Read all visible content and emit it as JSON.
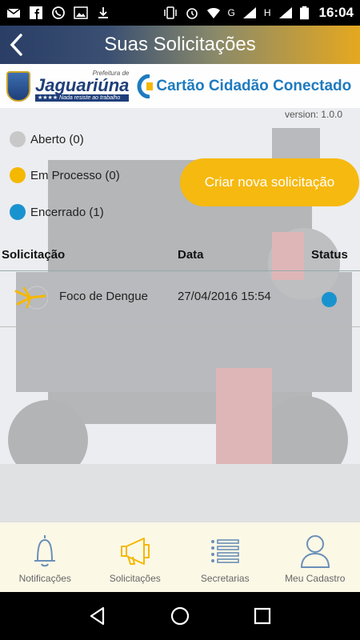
{
  "status_bar": {
    "time": "16:04",
    "network_g": "G",
    "network_h": "H",
    "left_icons": [
      "mail-icon",
      "facebook-icon",
      "whatsapp-icon",
      "image-icon",
      "download-icon"
    ],
    "right_icons": [
      "vibrate-icon",
      "alarm-icon",
      "wifi-icon",
      "signal-icon",
      "signal-icon",
      "battery-icon"
    ]
  },
  "header": {
    "title": "Suas Solicitações",
    "back_icon": "chevron-left-icon"
  },
  "logos": {
    "prefeitura_top": "Prefeitura de",
    "prefeitura_name": "Jaguariúna",
    "prefeitura_tagline": "★★★★ Nada resiste ao trabalho",
    "cartao": "Cartão Cidadão Conectado"
  },
  "version": "version: 1.0.0",
  "legend": [
    {
      "label": "Aberto (0)",
      "color": "#c8c8c8"
    },
    {
      "label": "Em Processo (0)",
      "color": "#f5b800"
    },
    {
      "label": "Encerrado (1)",
      "color": "#1993cf"
    }
  ],
  "new_request_button": "Criar nova solicitação",
  "table": {
    "headers": [
      "Solicitação",
      "Data",
      "Status"
    ],
    "rows": [
      {
        "name": "Foco de Dengue",
        "date": "27/04/2016 15:54",
        "status_color": "#1993cf",
        "icon": "mosquito-icon"
      }
    ]
  },
  "bottom_nav": [
    {
      "label": "Notificações",
      "icon": "bell-icon"
    },
    {
      "label": "Solicitações",
      "icon": "megaphone-icon",
      "active": true
    },
    {
      "label": "Secretarias",
      "icon": "list-icon"
    },
    {
      "label": "Meu Cadastro",
      "icon": "user-icon"
    }
  ],
  "system_nav": [
    "back-icon",
    "home-icon",
    "recents-icon"
  ],
  "colors": {
    "accent": "#f6b90f",
    "closed": "#1993cf",
    "header_dark": "#2a3e66"
  }
}
